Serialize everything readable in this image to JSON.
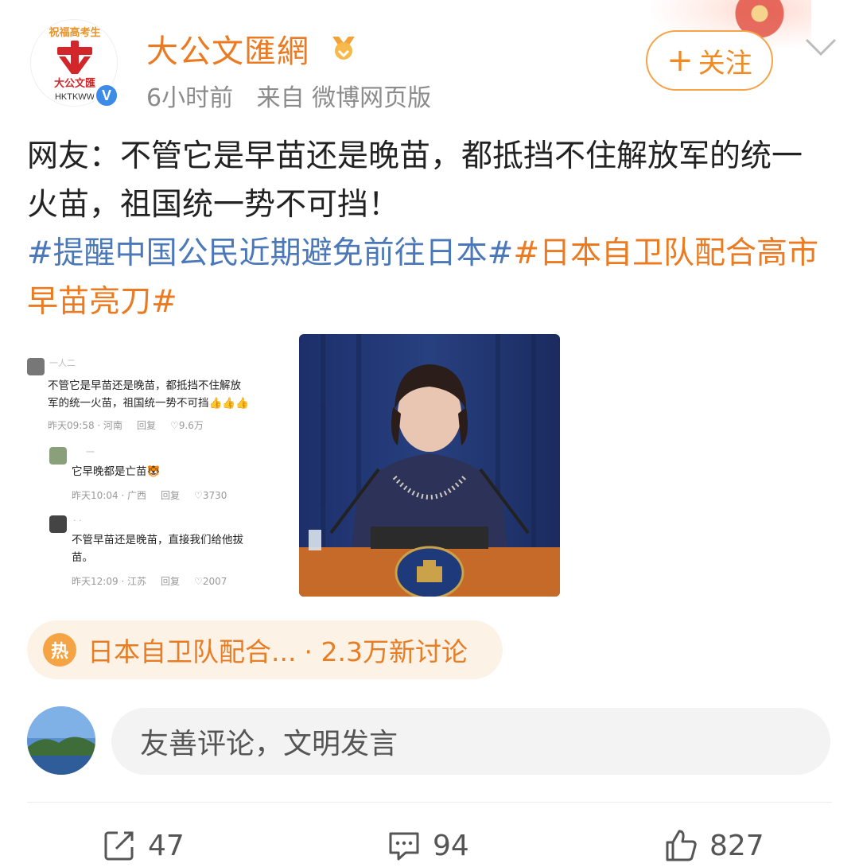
{
  "account": {
    "name": "大公文匯網",
    "avatar_text_top": "祝福高考生",
    "avatar_text_mid": "大公文匯",
    "avatar_text_bottom": "HKTKWW",
    "verified_mark": "V",
    "time": "6小时前",
    "source": "来自 微博网页版",
    "follow_label": "关注",
    "follow_plus": "+"
  },
  "post": {
    "text": "网友：不管它是早苗还是晚苗，都抵挡不住解放军的统一火苗，祖国统一势不可挡！",
    "topic_1": "#提醒中国公民近期避免前往日本#",
    "topic_2": "#日本自卫队配合高市早苗亮刀#"
  },
  "image": {
    "comments": [
      {
        "name": "一人二",
        "text_line1": "不管它是早苗还是晚苗，都抵挡不住解放",
        "text_line2": "军的统一火苗，祖国统一势不可挡👍👍👍",
        "time": "昨天09:58 · 河南",
        "reply": "回复",
        "likes": "9.6万"
      },
      {
        "name": "一",
        "text_line1": "它早晚都是亡苗🐯",
        "time": "昨天10:04 · 广西",
        "reply": "回复",
        "likes": "3730"
      },
      {
        "name": "· ·",
        "text_line1": "不管早苗还是晚苗，直接我们给他拔",
        "text_line2": "苗。",
        "time": "昨天12:09 · 江苏",
        "reply": "回复",
        "likes": "2007"
      }
    ]
  },
  "hot_topic": {
    "icon": "热",
    "text": "日本自卫队配合...",
    "count": "· 2.3万新讨论"
  },
  "comment_box": {
    "placeholder": "友善评论，文明发言"
  },
  "actions": {
    "repost_count": "47",
    "comment_count": "94",
    "like_count": "827"
  },
  "colors": {
    "accent": "#ec7a21",
    "topic_blue": "#4b78b8",
    "pill_bg": "#fdf2e6"
  }
}
